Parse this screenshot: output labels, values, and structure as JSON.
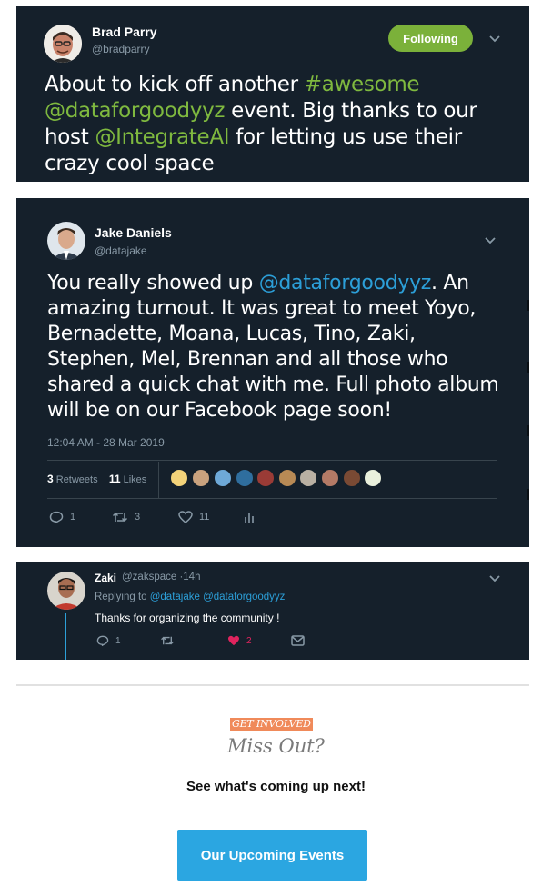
{
  "colors": {
    "card_bg": "#15202b",
    "follow_green": "#7bb13a",
    "mention_green": "#7fb93f",
    "mention_blue": "#2c9fd8",
    "muted": "#8899a6",
    "heart": "#e0245e",
    "cta_blue": "#2ba6e1",
    "tag_orange": "#f08a5a"
  },
  "tweet1": {
    "name": "Brad Parry",
    "handle": "@bradparry",
    "follow_label": "Following",
    "text_parts": {
      "t1": "About to kick off another ",
      "m1": "#awesome",
      "m2": "@dataforgoodyyz",
      "t2": " event.   Big thanks to our host ",
      "m3": "@IntegrateAI",
      "t3": " for letting us use their crazy cool space"
    }
  },
  "tweet2": {
    "name": "Jake Daniels",
    "handle": "@datajake",
    "text_parts": {
      "t1": "You really showed up ",
      "m1": "@dataforgoodyyz",
      "t2": ". An amazing turnout.  It was great to meet Yoyo, Bernadette, Moana, Lucas, Tino, Zaki, Stephen, Mel, Brennan and all those who shared a quick chat with me. Full photo album will be on our Facebook page soon!"
    },
    "timestamp": "12:04 AM - 28 Mar 2019",
    "retweets_count": "3",
    "retweets_label": "Retweets",
    "likes_count": "11",
    "likes_label": "Likes",
    "actions": {
      "replies": "1",
      "retweets": "3",
      "likes": "11"
    }
  },
  "reply": {
    "name": "Zaki",
    "handle_time": "@zakspace ·14h",
    "replying_prefix": "Replying to ",
    "replying_to_1": "@datajake",
    "replying_to_2": "@dataforgoodyyz",
    "text": "Thanks for organizing the community !",
    "actions": {
      "replies": "1",
      "likes": "2"
    }
  },
  "footer": {
    "tag": "GET INVOLVED",
    "heading": "Miss Out?",
    "subheading": "See what's coming up next!",
    "cta_label": "Our Upcoming Events"
  }
}
